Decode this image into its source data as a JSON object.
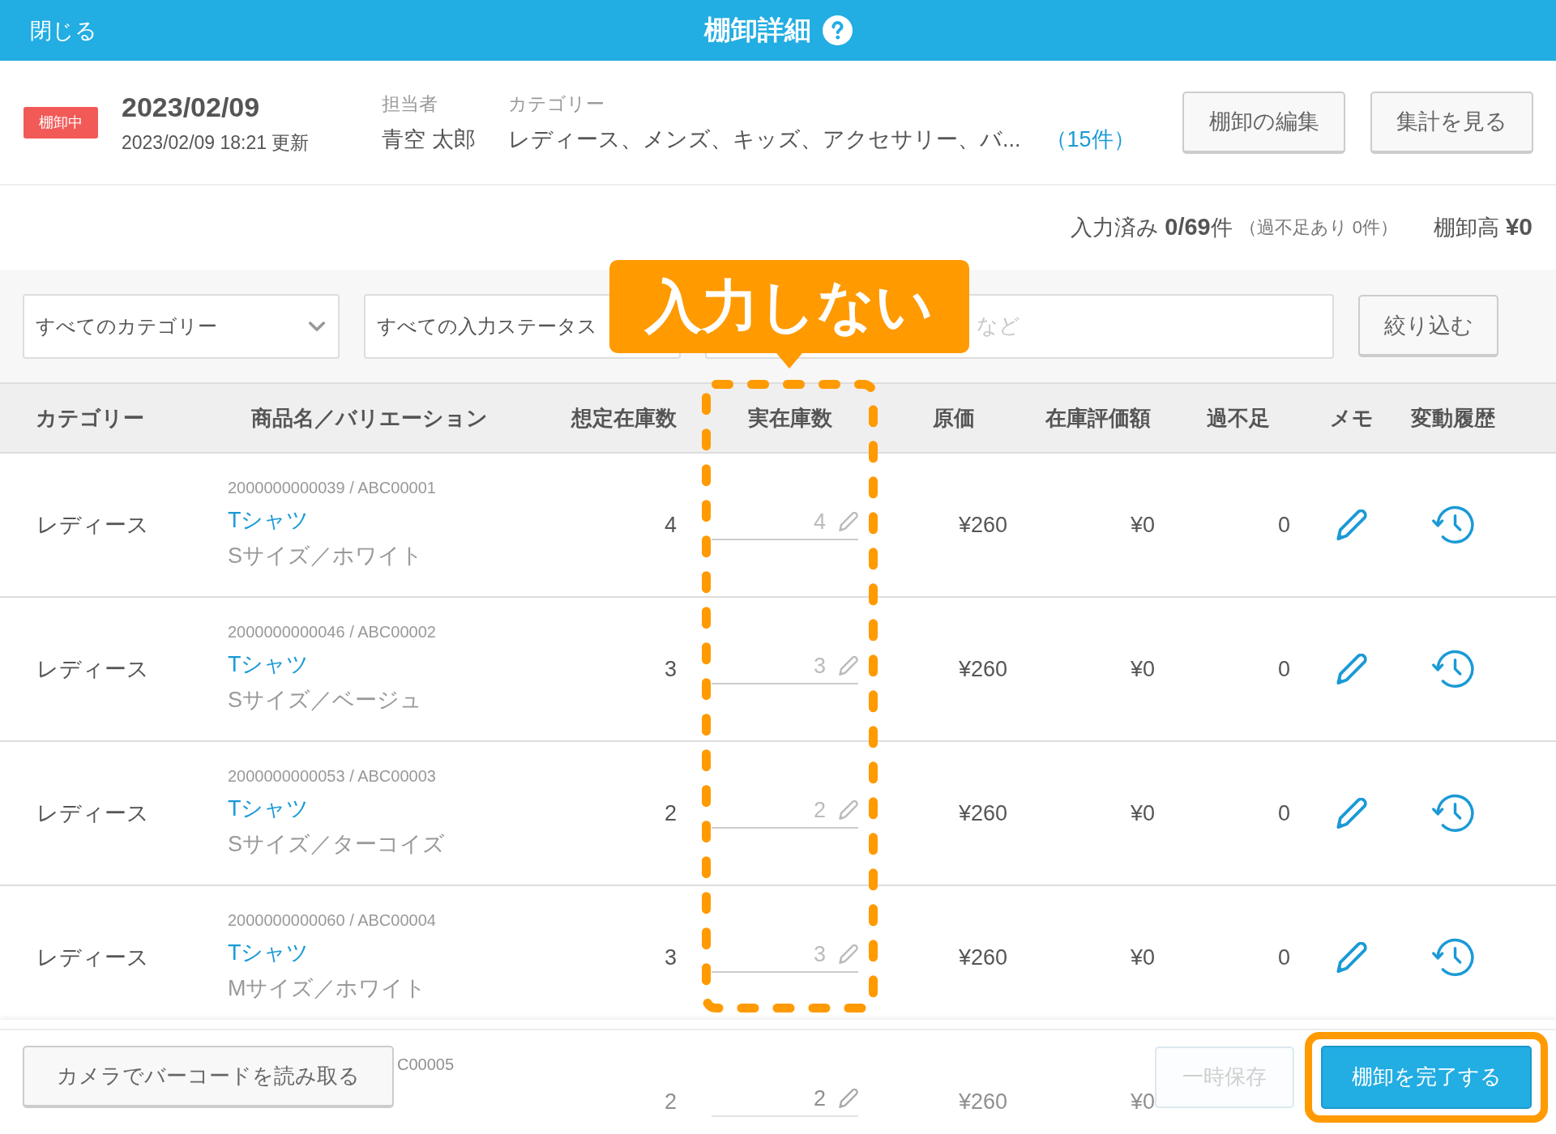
{
  "header": {
    "close": "閉じる",
    "title": "棚卸詳細"
  },
  "info": {
    "status": "棚卸中",
    "date": "2023/02/09",
    "updated": "2023/02/09 18:21 更新",
    "staff": {
      "label": "担当者",
      "value": "青空 太郎"
    },
    "categories": {
      "label": "カテゴリー",
      "value": "レディース、メンズ、キッズ、アクセサリー、バ...",
      "count": "（15件）"
    },
    "buttons": [
      "棚卸の編集",
      "集計を見る"
    ]
  },
  "summary": {
    "entered": "入力済み **0/69**件",
    "shortage": "（過不足あり 0件）",
    "total": "棚卸高 **¥0**"
  },
  "filters": {
    "selects": [
      {
        "kind": "dropdown",
        "value": "すべてのカテゴリー"
      },
      {
        "kind": "plain",
        "value": "すべての入力ステータス"
      }
    ],
    "search": {
      "placeholder": "など"
    },
    "button": "絞り込む"
  },
  "table": {
    "columns": [
      "カテゴリー",
      "商品名／バリエーション",
      "想定在庫数",
      "実在庫数",
      "原価",
      "在庫評価額",
      "過不足",
      "メモ",
      "変動履歴"
    ],
    "rows": [
      {
        "kind": "full",
        "category": "レディース",
        "code": "2000000000039 / ABC00001",
        "name": "Tシャツ",
        "variation": "Sサイズ／ホワイト",
        "expected": "4",
        "actual": {
          "placeholder": "4"
        },
        "cost": "¥260",
        "valuation": "¥0",
        "difference": "0"
      },
      {
        "kind": "full",
        "category": "レディース",
        "code": "2000000000046 / ABC00002",
        "name": "Tシャツ",
        "variation": "Sサイズ／ベージュ",
        "expected": "3",
        "actual": {
          "placeholder": "3"
        },
        "cost": "¥260",
        "valuation": "¥0",
        "difference": "0"
      },
      {
        "kind": "full",
        "category": "レディース",
        "code": "2000000000053 / ABC00003",
        "name": "Tシャツ",
        "variation": "Sサイズ／ターコイズ",
        "expected": "2",
        "actual": {
          "placeholder": "2"
        },
        "cost": "¥260",
        "valuation": "¥0",
        "difference": "0"
      },
      {
        "kind": "full",
        "category": "レディース",
        "code": "2000000000060 / ABC00004",
        "name": "Tシャツ",
        "variation": "Mサイズ／ホワイト",
        "expected": "3",
        "actual": {
          "placeholder": "3"
        },
        "cost": "¥260",
        "valuation": "¥0",
        "difference": "0"
      },
      {
        "kind": "partial",
        "code": "C00005",
        "expected": "2",
        "actual": {
          "placeholder": "2"
        },
        "cost": "¥260",
        "valuation": "¥0"
      }
    ]
  },
  "callout": "入力しない",
  "footer": {
    "camera": "カメラでバーコードを読み取る",
    "save": {
      "label": "一時保存",
      "disabled": true
    },
    "complete": "棚卸を完了する"
  }
}
